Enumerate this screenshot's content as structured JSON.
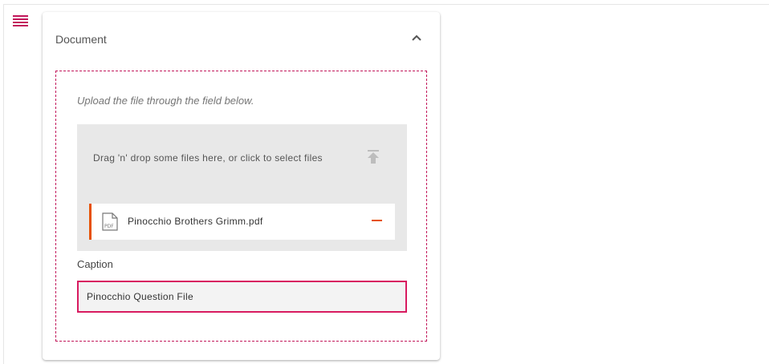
{
  "nav": {
    "menu_icon": "hamburger-menu-icon",
    "accent_color": "#c2185b"
  },
  "card": {
    "title": "Document",
    "collapse_icon": "chevron-up-icon",
    "hint": "Upload the file through the field below.",
    "dropzone": {
      "text": "Drag 'n' drop some files here, or click to select files",
      "icon": "upload-icon"
    },
    "files": [
      {
        "icon": "pdf-file-icon",
        "name": "Pinocchio Brothers Grimm.pdf",
        "remove_icon": "minus-icon",
        "accent_color": "#e65100"
      }
    ],
    "caption": {
      "label": "Caption",
      "value": "Pinocchio Question File",
      "border_color": "#d81b60"
    }
  }
}
